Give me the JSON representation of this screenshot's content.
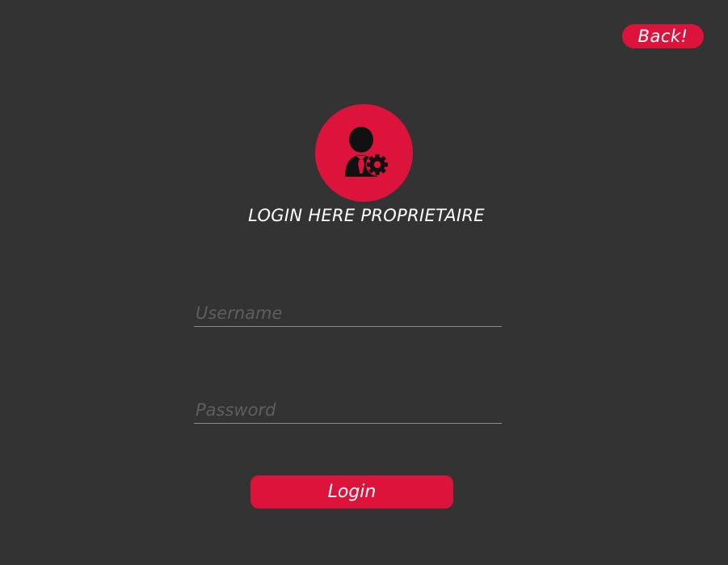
{
  "header": {
    "back_label": "Back!"
  },
  "login": {
    "title": "LOGIN HERE PROPRIETAIRE",
    "username_placeholder": "Username",
    "password_placeholder": "Password",
    "submit_label": "Login"
  },
  "icons": {
    "avatar": "user-with-gear-icon"
  },
  "colors": {
    "background": "#333333",
    "accent": "#dc143c",
    "text": "#ffffff",
    "placeholder": "#5e5e5e",
    "underline": "#8a8a8a"
  }
}
